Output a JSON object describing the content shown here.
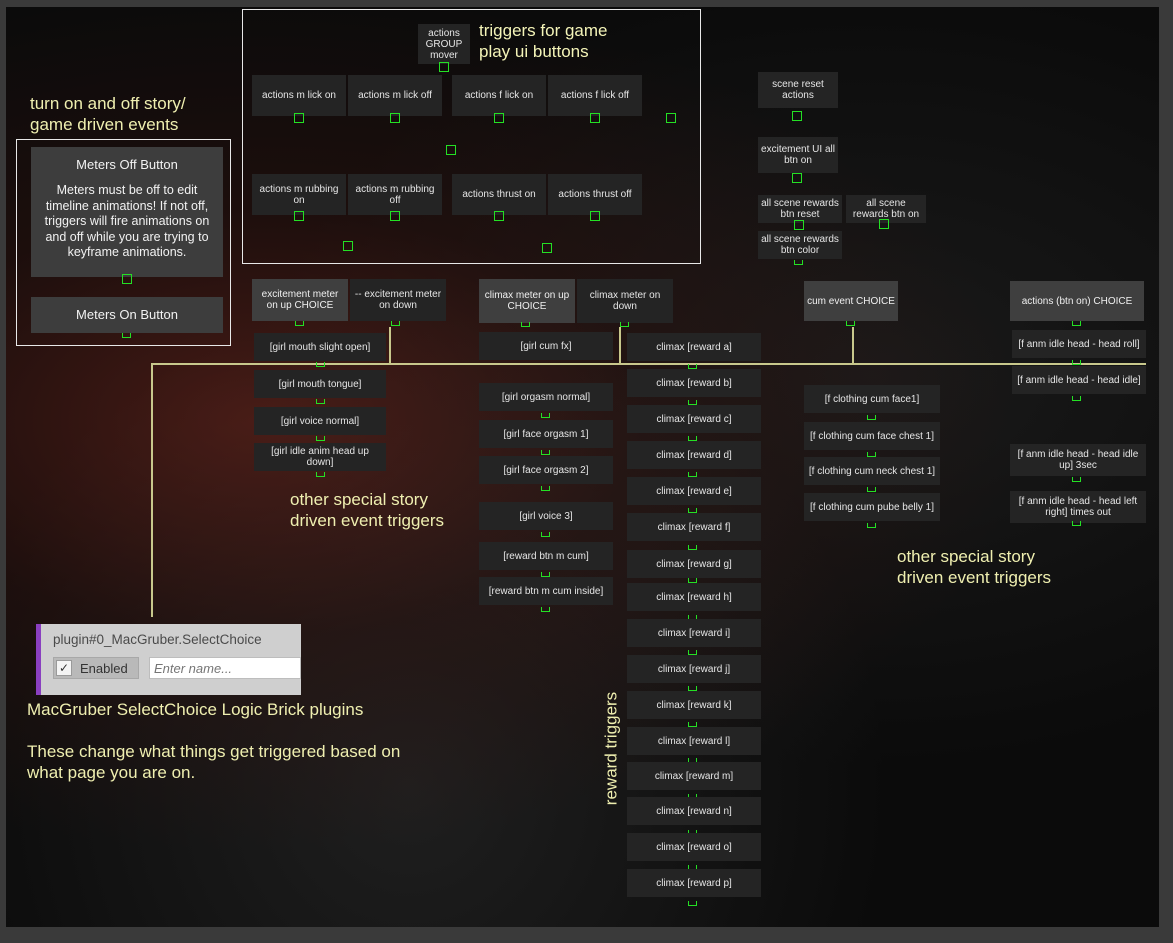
{
  "annotations": {
    "ui_buttons_1": "triggers for game",
    "ui_buttons_2": "play ui buttons",
    "story_events_1": "turn on and off story/",
    "story_events_2": "game driven events",
    "special_left_1": "other special story",
    "special_left_2": "driven event triggers",
    "special_right_1": "other special story",
    "special_right_2": "driven event triggers",
    "reward_triggers": "reward triggers",
    "macgruber_title": "MacGruber SelectChoice Logic Brick plugins",
    "macgruber_desc_1": "These change what things get triggered based on",
    "macgruber_desc_2": "what page you are on."
  },
  "meters": {
    "off_label": "Meters Off Button",
    "off_desc": "Meters must be off to edit timeline animations! If not off, triggers will fire animations on and off while you are trying to keyframe animations.",
    "on_label": "Meters On Button"
  },
  "ui_actions": {
    "group_mover": "actions GROUP mover",
    "m_lick_on": "actions m lick on",
    "m_lick_off": "actions m lick off",
    "f_lick_on": "actions f lick on",
    "f_lick_off": "actions f lick off",
    "m_rubbing_on": "actions m rubbing on",
    "m_rubbing_off": "actions m rubbing off",
    "thrust_on": "actions thrust on",
    "thrust_off": "actions thrust off"
  },
  "scene": {
    "reset": "scene reset actions",
    "excitement_ui": "excitement UI all btn on",
    "rewards_reset": "all scene rewards btn reset",
    "rewards_on": "all scene rewards btn on",
    "rewards_color": "all scene rewards btn color"
  },
  "choices": {
    "excitement_up": "excitement meter on up CHOICE",
    "excitement_down": "-- excitement meter on down",
    "climax_up": "climax meter on up CHOICE",
    "climax_down": "climax meter on down",
    "cum_event": "cum event CHOICE",
    "actions_btn": "actions (btn on) CHOICE"
  },
  "girl_left": {
    "mouth_open": "[girl mouth slight open]",
    "mouth_tongue": "[girl mouth tongue]",
    "voice_normal": "[girl voice normal]",
    "idle_head": "[girl idle anim head up down]"
  },
  "climax_up_list": {
    "cum_fx": "[girl cum fx]",
    "orgasm_normal": "[girl orgasm normal]",
    "face_orgasm_1": "[girl face orgasm 1]",
    "face_orgasm_2": "[girl face orgasm 2]",
    "voice_3": "[girl voice 3]",
    "m_cum": "[reward btn m cum]",
    "m_cum_inside": "[reward btn m cum inside]"
  },
  "rewards": [
    "climax [reward a]",
    "climax [reward b]",
    "climax [reward c]",
    "climax [reward d]",
    "climax [reward e]",
    "climax [reward f]",
    "climax [reward g]",
    "climax [reward h]",
    "climax [reward i]",
    "climax [reward j]",
    "climax [reward k]",
    "climax [reward l]",
    "climax [reward m]",
    "climax [reward n]",
    "climax [reward o]",
    "climax [reward p]"
  ],
  "cum_list": {
    "face1": "[f clothing cum face1]",
    "face_chest": "[f clothing cum face chest 1]",
    "neck_chest": "[f clothing cum neck chest 1]",
    "pube_belly": "[f clothing cum pube belly 1]"
  },
  "head_list": {
    "roll": "[f anm idle head - head roll]",
    "idle": "[f anm idle head - head idle]",
    "idle_up": "[f anm idle head - head idle up] 3sec",
    "left_right": "[f anm idle head - head left right] times out"
  },
  "plugin": {
    "name": "plugin#0_MacGruber.SelectChoice",
    "enabled_label": "Enabled",
    "name_placeholder": "Enter name..."
  },
  "colors": {
    "connector": "#24e024",
    "annotation": "#efefb0",
    "plugin_accent": "#8a3fc0"
  }
}
